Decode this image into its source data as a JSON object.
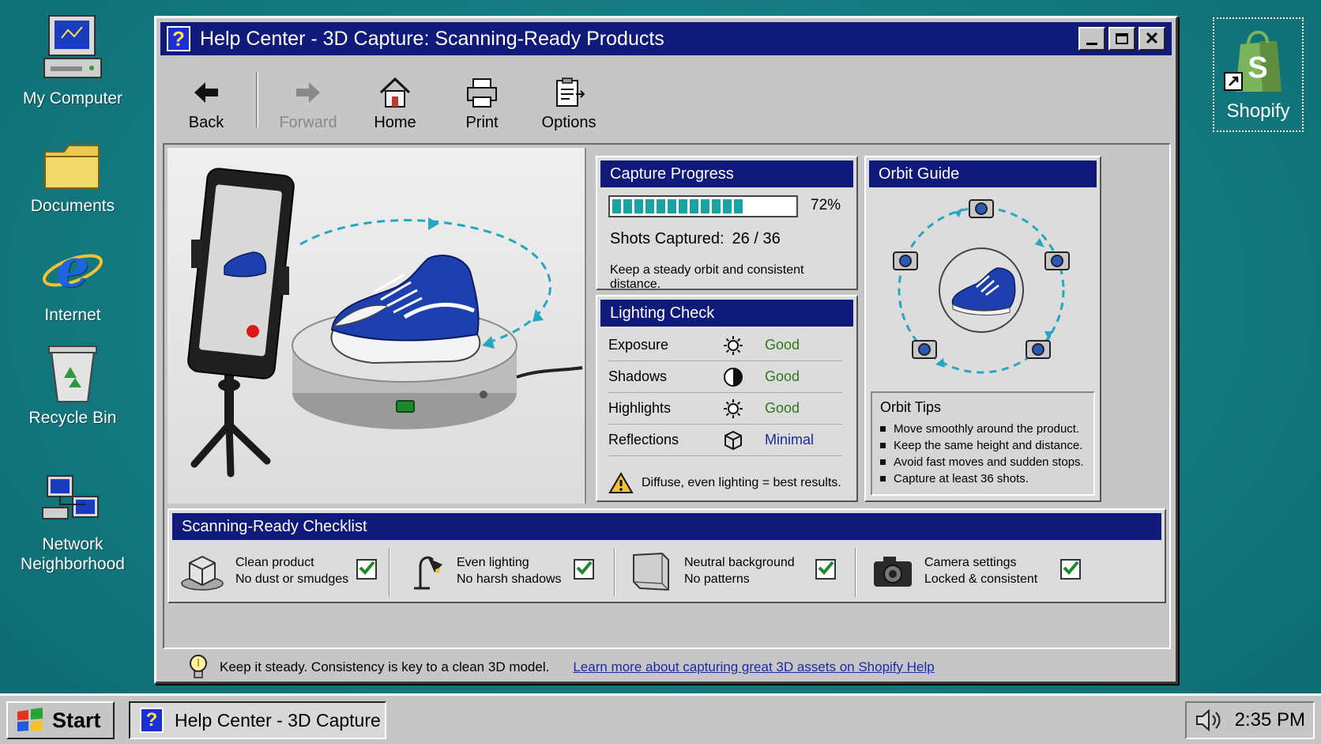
{
  "desktop": {
    "icons": [
      {
        "label": "My Computer"
      },
      {
        "label": "Documents"
      },
      {
        "label": "Internet"
      },
      {
        "label": "Recycle Bin"
      },
      {
        "label": "Network Neighborhood"
      }
    ],
    "shortcut": {
      "label": "Shopify",
      "logo_letter": "S"
    }
  },
  "window": {
    "title": "Help Center - 3D Capture:  Scanning-Ready Products",
    "title_icon": "?"
  },
  "toolbar": {
    "back": "Back",
    "forward": "Forward",
    "home": "Home",
    "print": "Print",
    "options": "Options"
  },
  "capture_progress": {
    "header": "Capture Progress",
    "progress": 0.72,
    "percent_label": "72%",
    "shots_label": "Shots Captured:",
    "shots_value": "26 / 36",
    "tip": "Keep a steady orbit and consistent distance."
  },
  "lighting_check": {
    "header": "Lighting Check",
    "rows": [
      {
        "name": "Exposure",
        "icon": "sun-icon",
        "status": "Good"
      },
      {
        "name": "Shadows",
        "icon": "half-circle-icon",
        "status": "Good"
      },
      {
        "name": "Highlights",
        "icon": "sun-icon",
        "status": "Good"
      },
      {
        "name": "Reflections",
        "icon": "cube-icon",
        "status": "Minimal"
      }
    ],
    "note": "Diffuse, even lighting = best results."
  },
  "orbit_guide": {
    "header": "Orbit Guide",
    "tips_header": "Orbit Tips",
    "tips": [
      "Move smoothly around the product.",
      "Keep the same height and distance.",
      "Avoid fast moves and sudden stops.",
      "Capture at least 36 shots."
    ]
  },
  "checklist": {
    "header": "Scanning-Ready Checklist",
    "items": [
      {
        "title": "Clean product",
        "subtitle": "No dust or smudges",
        "checked": true
      },
      {
        "title": "Even lighting",
        "subtitle": "No harsh shadows",
        "checked": true
      },
      {
        "title": "Neutral background",
        "subtitle": "No patterns",
        "checked": true
      },
      {
        "title": "Camera settings",
        "subtitle": "Locked & consistent",
        "checked": true
      }
    ]
  },
  "status": {
    "tip": "Keep it steady. Consistency is key to a clean 3D model.",
    "link": "Learn more about capturing great 3D assets on Shopify Help"
  },
  "taskbar": {
    "start": "Start",
    "task": "Help Center - 3D Capture",
    "time": "2:35 PM"
  },
  "colors": {
    "titlebar": "#0f1a7a",
    "desktop": "#137a80",
    "progress_fill": "#1aa3a3",
    "good": "#2a7a1a",
    "link": "#1a2aa0",
    "shoe": "#1d3fb0"
  }
}
